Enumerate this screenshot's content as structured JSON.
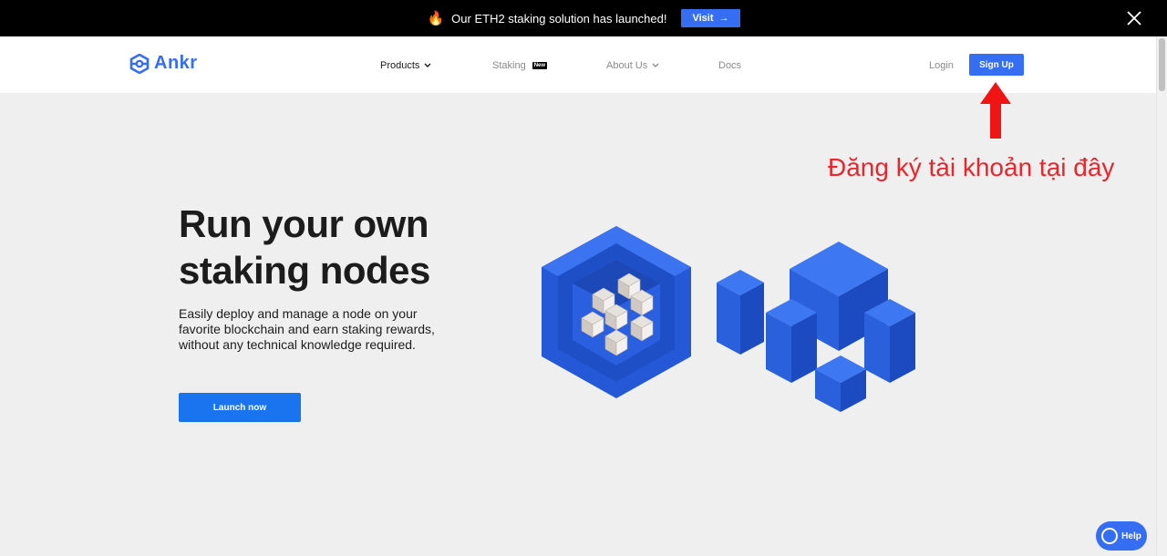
{
  "announcement": {
    "icon": "fire-icon",
    "message": "Our ETH2 staking solution has launched!",
    "visit_label": "Visit",
    "visit_arrow": "→",
    "close_icon": "close-icon"
  },
  "header": {
    "logo_text": "Ankr",
    "nav": {
      "products": "Products",
      "staking": "Staking",
      "staking_badge": "New",
      "about": "About Us",
      "docs": "Docs"
    },
    "login": "Login",
    "signup": "Sign Up"
  },
  "annotation": {
    "text": "Đăng ký tài khoản tại đây",
    "color": "#e8262b"
  },
  "hero": {
    "title": "Run your own staking nodes",
    "description": "Easily deploy and manage a node on your favorite blockchain and earn staking rewards, without any technical knowledge required.",
    "cta": "Launch now"
  },
  "help": {
    "label": "Help"
  },
  "colors": {
    "brand": "#356df3",
    "background": "#efeff0",
    "topbar": "#000000"
  }
}
